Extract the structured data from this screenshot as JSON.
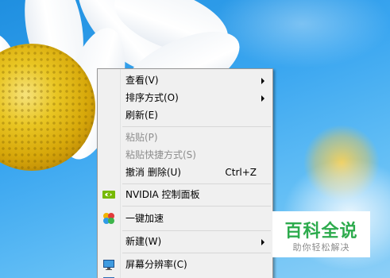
{
  "menu": {
    "items": [
      {
        "label": "查看(V)",
        "submenu": true
      },
      {
        "label": "排序方式(O)",
        "submenu": true
      },
      {
        "label": "刷新(E)"
      },
      {
        "label": "粘贴(P)",
        "disabled": true
      },
      {
        "label": "粘贴快捷方式(S)",
        "disabled": true
      },
      {
        "label": "撤消 删除(U)",
        "shortcut": "Ctrl+Z"
      },
      {
        "label": "NVIDIA 控制面板",
        "icon": "nvidia-icon"
      },
      {
        "label": "一键加速",
        "icon": "speedup-icon"
      },
      {
        "label": "新建(W)",
        "submenu": true
      },
      {
        "label": "屏幕分辨率(C)",
        "icon": "display-icon"
      }
    ]
  },
  "watermark": {
    "title": "百科全说",
    "subtitle": "助你轻松解决"
  },
  "colors": {
    "menu_background": "#f0f0f0",
    "watermark_green": "#2dab4d",
    "sky_blue": "#3aa6f0"
  }
}
